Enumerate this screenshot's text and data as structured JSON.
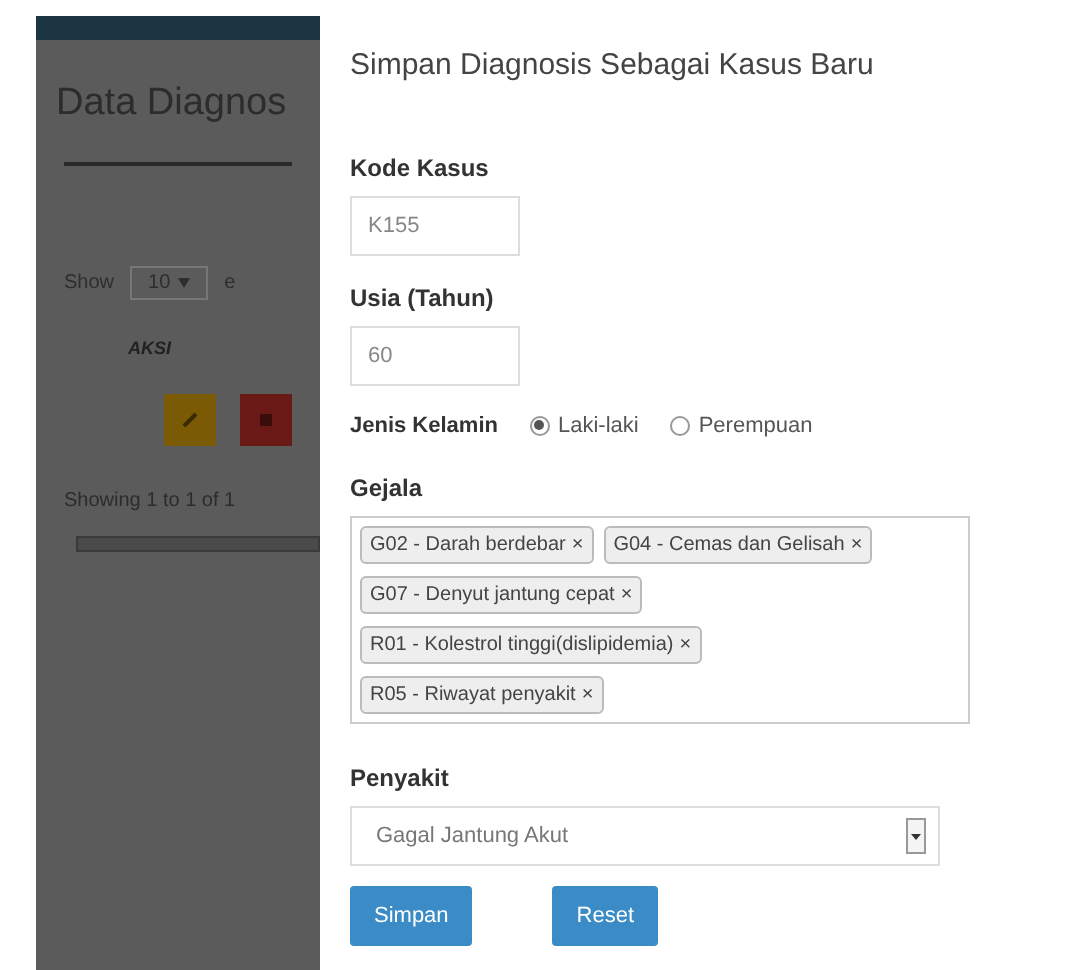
{
  "background_page": {
    "title": "Data Diagnos",
    "show_label": "Show",
    "entries_value": "10",
    "entries_label": "e",
    "column_header": "AKSI",
    "footer": "Showing 1 to 1 of 1"
  },
  "modal": {
    "title": "Simpan Diagnosis Sebagai Kasus Baru",
    "kode_kasus": {
      "label": "Kode Kasus",
      "value": "K155"
    },
    "usia": {
      "label": "Usia (Tahun)",
      "value": "60"
    },
    "jenis_kelamin": {
      "label": "Jenis Kelamin",
      "options": [
        {
          "label": "Laki-laki",
          "selected": true
        },
        {
          "label": "Perempuan",
          "selected": false
        }
      ]
    },
    "gejala": {
      "label": "Gejala",
      "tags": [
        {
          "text": "G02 - Darah berdebar",
          "remove": "×"
        },
        {
          "text": "G04 - Cemas dan Gelisah",
          "remove": "×"
        },
        {
          "text": "G07 - Denyut jantung cepat",
          "remove": "×"
        },
        {
          "text": "R01 - Kolestrol tinggi(dislipidemia)",
          "remove": "×"
        },
        {
          "text": "R05 - Riwayat penyakit",
          "remove": "×"
        }
      ]
    },
    "penyakit": {
      "label": "Penyakit",
      "value": "Gagal Jantung Akut"
    },
    "buttons": [
      "Simpan",
      "Reset"
    ]
  }
}
